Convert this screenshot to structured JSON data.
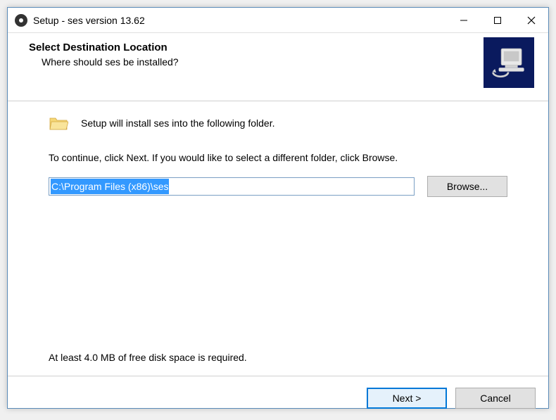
{
  "titlebar": {
    "title": "Setup - ses version 13.62"
  },
  "header": {
    "title": "Select Destination Location",
    "subtitle": "Where should ses be installed?"
  },
  "content": {
    "intro": "Setup will install ses into the following folder.",
    "instruction": "To continue, click Next. If you would like to select a different folder, click Browse.",
    "install_path": "C:\\Program Files (x86)\\ses",
    "browse_label": "Browse...",
    "disk_space": "At least 4.0 MB of free disk space is required."
  },
  "footer": {
    "next_label": "Next >",
    "cancel_label": "Cancel"
  }
}
